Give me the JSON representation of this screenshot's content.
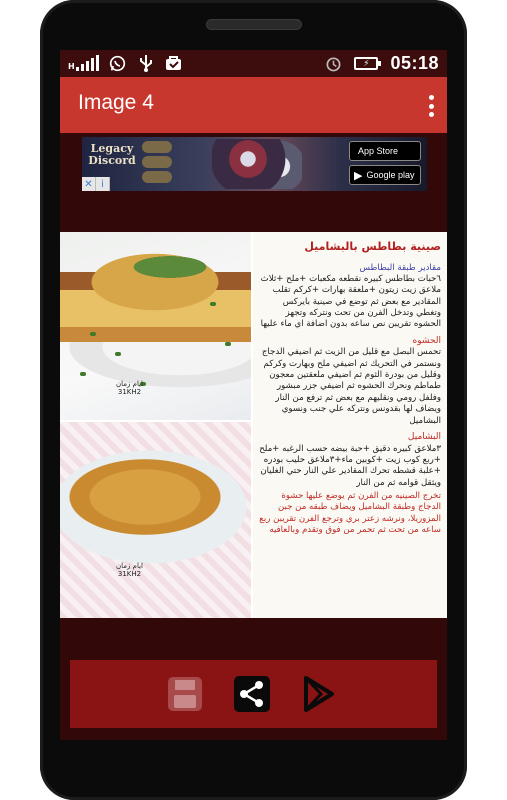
{
  "status_bar": {
    "time": "05:18",
    "network_label": "H"
  },
  "app_bar": {
    "title": "Image 4"
  },
  "ad_banner": {
    "game_logo_line1": "Legacy",
    "game_logo_line2": "Discord",
    "app_store_label": "App Store",
    "google_play_label": "Google play"
  },
  "recipe": {
    "title": "صينية بطاطس بالبشاميل",
    "section1_heading": "مقادير طبقة البطاطس",
    "section1_text": "٦حبات بطاطس كبيره نقطعه مكعبات +ملح +ثلاث ملاعق زيت زيتون +ملعقة بهارات +كركم تقلب المقادير مع بعض ثم توضع في صينية بايركس وتغطي وتدخل الفرن من تحت ونتركه وتجهز الحشوه تقريبن نص ساعه بدون اضافة اي ماء عليها",
    "section2_heading": "الحشوه",
    "section2_text": "تحمس البصل مع قليل من الزيت ثم اضيفي الدجاج ونستمر في التحريك ثم اضيفي ملح وبهارت وكركم وقليل من بودرة الثوم ثم اضيفي ملعقتين معجون طماطم ونحرك الحشوه ثم اضيفي جزر مبشور وفلفل رومي ونقليهم مع بعض ثم ترفع من النار ويضاف لها بقدونس ونتركه علي جنب ونسوي البشاميل",
    "section3_heading": "البشاميل",
    "section3_text": "٣ملاعق كبيره دقيق +حبة بيضه حسب الرغبه +ملح +ربع كوب زيت +كوبين ماء+٣ملاعق حليب بودره +علبة قشطه تحرك المقادير علي النار حتي الغليان ويثقل قوامه ثم من النار",
    "section4_text": "تخرج الصينيه من الفرن ثم يوضع عليها حشوة الدجاج وطبقة البشاميل ويضاف طبقه من جبن المزوريلا، ونرشه زعتر بري وترجع الفرن تقريبن ربع ساعه من تحت ثم تحمر من فوق وتقدم وبالعافيه"
  },
  "watermarks": {
    "photo1_line1": "ايام زمان",
    "photo1_line2": "31KH2",
    "photo2_line1": "ايام زمان",
    "photo2_line2": "31KH2"
  },
  "bottom_bar": {
    "save_icon": "save-icon",
    "share_icon": "share-icon",
    "play_icon": "play-store-icon"
  }
}
